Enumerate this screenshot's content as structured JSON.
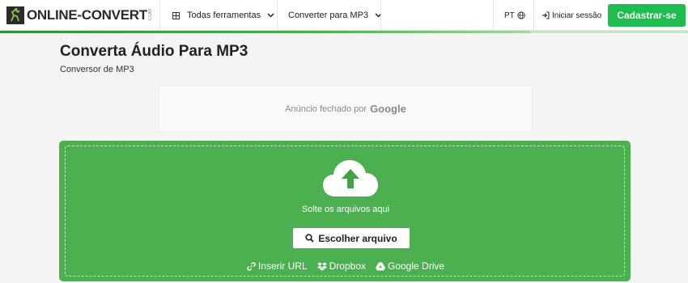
{
  "header": {
    "logo_text": "ONLINE-CONVERT",
    "logo_suffix": ".COM",
    "nav": {
      "all_tools_label": "Todas ferramentas",
      "convert_label": "Converter para MP3"
    },
    "language_label": "PT",
    "login_label": "Iniciar sessão",
    "signup_label": "Cadastrar-se"
  },
  "progress": {
    "fraction": 0.77
  },
  "main": {
    "title": "Converta Áudio Para MP3",
    "subtitle": "Conversor de MP3"
  },
  "ad": {
    "text": "Anúncio fechado por",
    "brand": "Google"
  },
  "dropzone": {
    "drop_text": "Solte os arquivos aqui",
    "choose_label": "Escolher arquivo",
    "links": {
      "url_label": "Inserir URL",
      "dropbox_label": "Dropbox",
      "gdrive_label": "Google Drive"
    }
  },
  "colors": {
    "accent_green": "#4caf50",
    "signup_green": "#1fbd4e"
  },
  "icons": [
    "logo-icon",
    "grid-icon",
    "chevron-down-icon",
    "globe-icon",
    "sign-in-icon",
    "cloud-upload-icon",
    "search-icon",
    "link-icon",
    "dropbox-icon",
    "google-drive-icon"
  ]
}
